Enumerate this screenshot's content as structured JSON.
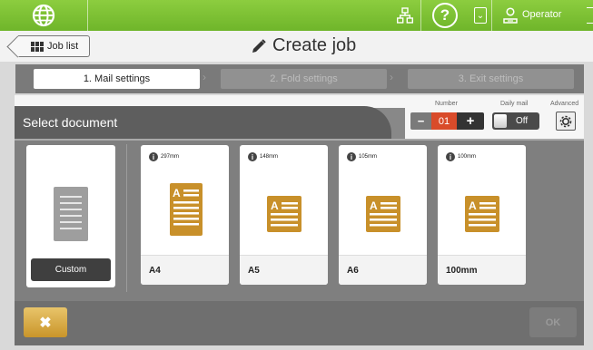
{
  "topbar": {
    "icons": [
      "globe-icon",
      "network-icon",
      "help-icon",
      "chevron-down-icon",
      "operator-icon"
    ],
    "help_symbol": "?",
    "operator_label": "Operator",
    "accent": "#7cc035"
  },
  "header": {
    "job_list_label": "Job list",
    "title": "Create job"
  },
  "steps": [
    {
      "label": "1. Mail settings",
      "active": true
    },
    {
      "label": "2. Fold settings",
      "active": false
    },
    {
      "label": "3. Exit settings",
      "active": false
    }
  ],
  "main": {
    "section_title": "Select document",
    "number": {
      "label": "Number",
      "value": "01",
      "minus": "−",
      "plus": "+",
      "accent": "#d94b2a"
    },
    "daily_mail": {
      "label": "Daily mail",
      "state": "Off"
    },
    "advanced": {
      "label": "Advanced"
    }
  },
  "documents": [
    {
      "name": "Custom",
      "size": "",
      "custom": true
    },
    {
      "name": "A4",
      "size": "297mm"
    },
    {
      "name": "A5",
      "size": "148mm"
    },
    {
      "name": "A6",
      "size": "105mm"
    },
    {
      "name": "100mm",
      "size": "100mm"
    }
  ],
  "doc_icon_color": "#c8902a",
  "footer": {
    "cancel_symbol": "✖",
    "ok_label": "OK"
  }
}
